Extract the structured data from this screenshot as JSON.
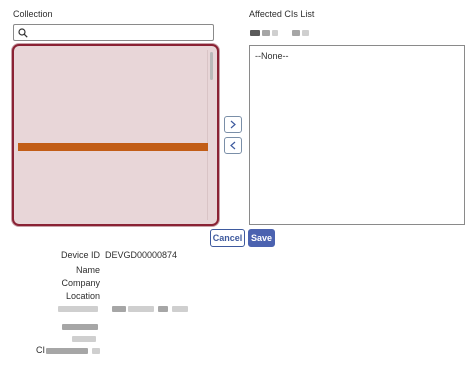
{
  "collection": {
    "label": "Collection",
    "search_placeholder": ""
  },
  "affected": {
    "label": "Affected CIs List",
    "empty_item": "--None--"
  },
  "buttons": {
    "add": ">",
    "remove": "<",
    "cancel": "Cancel",
    "save": "Save"
  },
  "details": {
    "device_id_label": "Device ID",
    "device_id_value": "DEVGD00000874",
    "name_label": "Name",
    "company_label": "Company",
    "location_label": "Location",
    "ci_label": "CI"
  },
  "colors": {
    "accent": "#4b62b0",
    "list_border": "#8a2234",
    "selected_row": "#c25d16"
  },
  "icons": {
    "search": "search-icon",
    "right": "chevron-right-icon",
    "left": "chevron-left-icon"
  }
}
